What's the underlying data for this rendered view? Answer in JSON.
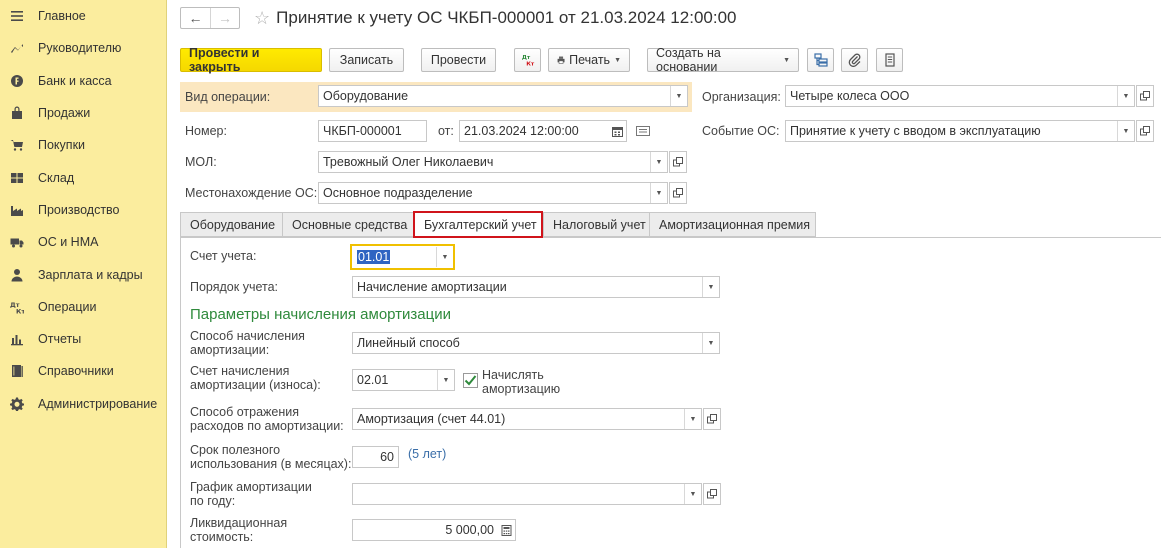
{
  "sidebar": {
    "items": [
      {
        "label": "Главное",
        "icon": "menu-icon"
      },
      {
        "label": "Руководителю",
        "icon": "chart-line-icon"
      },
      {
        "label": "Банк и касса",
        "icon": "coin-icon"
      },
      {
        "label": "Продажи",
        "icon": "bag-icon"
      },
      {
        "label": "Покупки",
        "icon": "cart-icon"
      },
      {
        "label": "Склад",
        "icon": "warehouse-icon"
      },
      {
        "label": "Производство",
        "icon": "factory-icon"
      },
      {
        "label": "ОС и НМА",
        "icon": "truck-icon"
      },
      {
        "label": "Зарплата и кадры",
        "icon": "person-icon"
      },
      {
        "label": "Операции",
        "icon": "dt-kt-icon"
      },
      {
        "label": "Отчеты",
        "icon": "bar-chart-icon"
      },
      {
        "label": "Справочники",
        "icon": "book-icon"
      },
      {
        "label": "Администрирование",
        "icon": "gear-icon"
      }
    ]
  },
  "header": {
    "title": "Принятие к учету ОС ЧКБП-000001 от 21.03.2024 12:00:00"
  },
  "toolbar": {
    "post_close": "Провести и закрыть",
    "save": "Записать",
    "post": "Провести",
    "dtkt": "ДтКт",
    "print": "Печать",
    "create_based": "Создать на основании"
  },
  "form": {
    "op_type_label": "Вид операции:",
    "op_type_value": "Оборудование",
    "org_label": "Организация:",
    "org_value": "Четыре колеса ООО",
    "number_label": "Номер:",
    "number_value": "ЧКБП-000001",
    "date_label": "от:",
    "date_value": "21.03.2024 12:00:00",
    "event_label": "Событие ОС:",
    "event_value": "Принятие к учету с вводом в эксплуатацию",
    "mol_label": "МОЛ:",
    "mol_value": "Тревожный Олег Николаевич",
    "location_label": "Местонахождение ОС:",
    "location_value": "Основное подразделение"
  },
  "tabs": [
    {
      "label": "Оборудование"
    },
    {
      "label": "Основные средства"
    },
    {
      "label": "Бухгалтерский учет",
      "active": true
    },
    {
      "label": "Налоговый учет"
    },
    {
      "label": "Амортизационная премия"
    }
  ],
  "accounting": {
    "account_label": "Счет учета:",
    "account_value": "01.01",
    "procedure_label": "Порядок учета:",
    "procedure_value": "Начисление амортизации",
    "params_title": "Параметры начисления амортизации",
    "method_label_1": "Способ начисления",
    "method_label_2": "амортизации:",
    "method_value": "Линейный способ",
    "dep_account_label_1": "Счет начисления",
    "dep_account_label_2": "амортизации (износа):",
    "dep_account_value": "02.01",
    "charge_label_1": "Начислять",
    "charge_label_2": "амортизацию",
    "charge_checked": true,
    "expense_label_1": "Способ отражения",
    "expense_label_2": "расходов по амортизации:",
    "expense_value": "Амортизация (счет 44.01)",
    "life_label_1": "Срок полезного",
    "life_label_2": "использования (в месяцах):",
    "life_value": "60",
    "life_years": "(5 лет)",
    "schedule_label_1": "График амортизации",
    "schedule_label_2": "по году:",
    "schedule_value": "",
    "salvage_label_1": "Ликвидационная",
    "salvage_label_2": "стоимость:",
    "salvage_value": "5 000,00"
  },
  "colors": {
    "sidebar_bg": "#fbed9e",
    "primary_button": "#f5d800",
    "section_title": "#2f8a3c",
    "active_tab_border": "#d0141b",
    "focus_border": "#f0c000"
  }
}
